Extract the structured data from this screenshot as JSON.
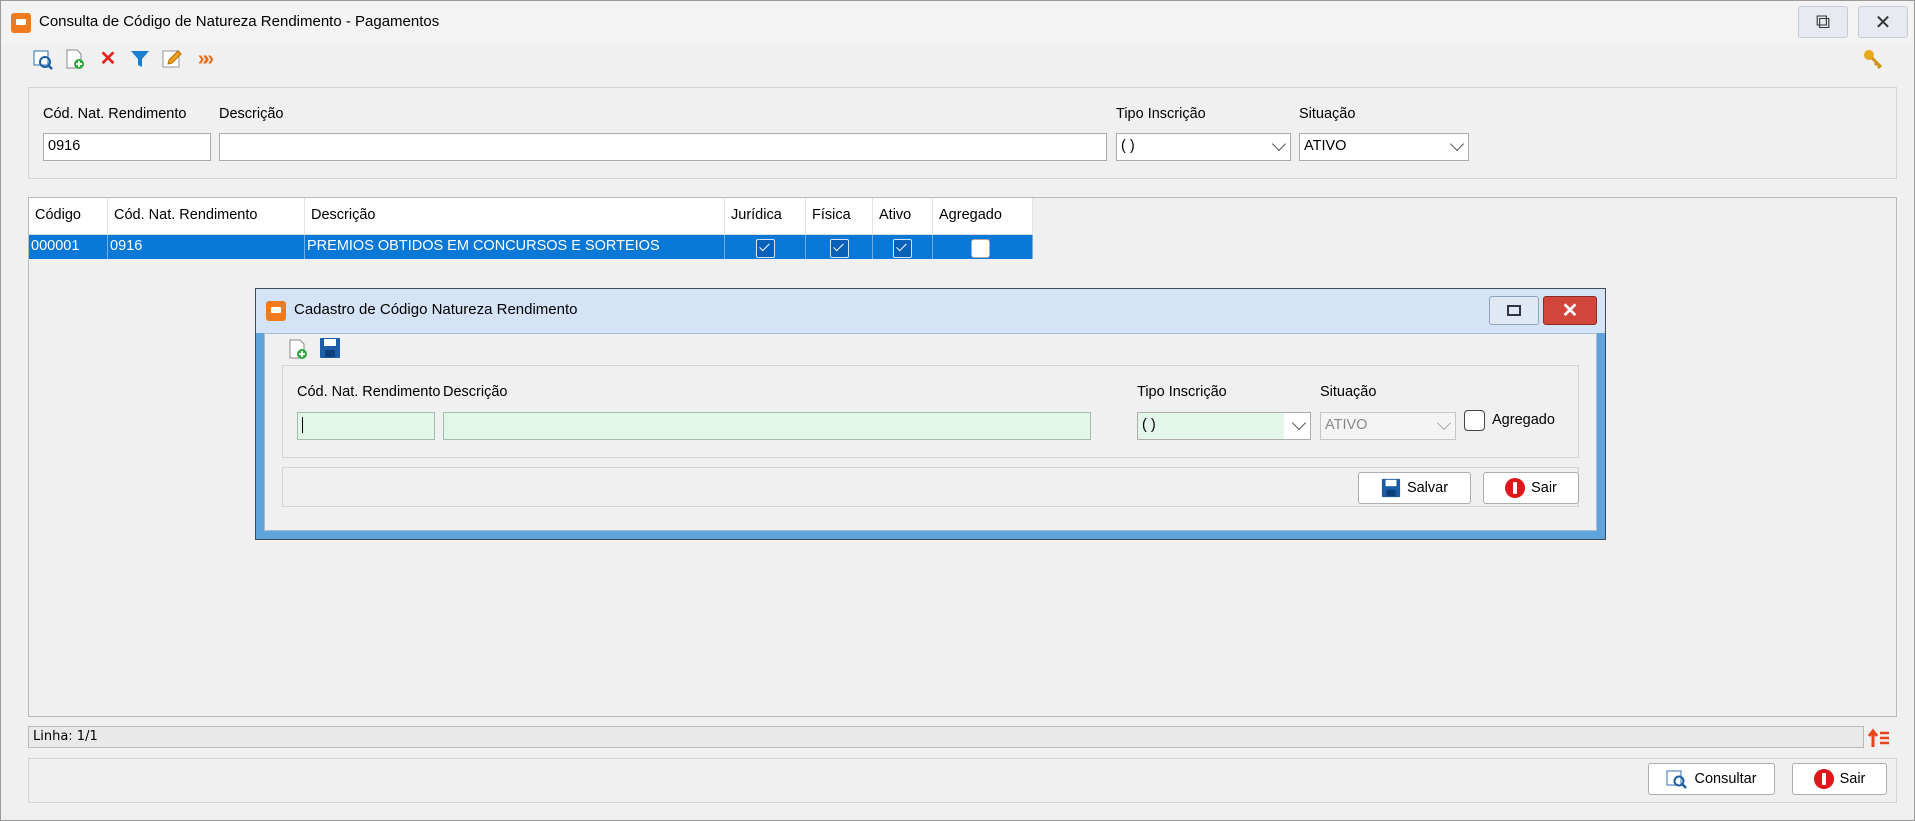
{
  "window": {
    "title": "Consulta de Código de Natureza Rendimento - Pagamentos"
  },
  "toolbar": {
    "icons": [
      "search-icon",
      "new-document-icon",
      "delete-icon",
      "filter-icon",
      "edit-icon",
      "next-icon"
    ],
    "key_icon": "key-icon"
  },
  "filter": {
    "cod_label": "Cód. Nat. Rendimento",
    "cod_value": "0916",
    "descricao_label": "Descrição",
    "descricao_value": "",
    "tipo_label": "Tipo Inscrição",
    "tipo_value": "(   )",
    "situacao_label": "Situação",
    "situacao_value": "ATIVO"
  },
  "grid": {
    "columns": [
      "Código",
      "Cód. Nat. Rendimento",
      "Descrição",
      "Jurídica",
      "Física",
      "Ativo",
      "Agregado"
    ],
    "rows": [
      {
        "codigo": "000001",
        "cod_nat": "0916",
        "descricao": "PREMIOS OBTIDOS EM CONCURSOS E SORTEIOS",
        "juridica": true,
        "fisica": true,
        "ativo": true,
        "agregado": false
      }
    ]
  },
  "status": {
    "linha": "Linha: 1/1"
  },
  "buttons": {
    "consultar": "Consultar",
    "sair": "Sair"
  },
  "dialog": {
    "title": "Cadastro de Código Natureza Rendimento",
    "cod_label": "Cód. Nat. Rendimento",
    "cod_value": "",
    "descricao_label": "Descrição",
    "descricao_value": "",
    "tipo_label": "Tipo Inscrição",
    "tipo_value": "(   )",
    "situacao_label": "Situação",
    "situacao_value": "ATIVO",
    "agregado_label": "Agregado",
    "salvar": "Salvar",
    "sair": "Sair"
  },
  "colors": {
    "selection": "#0a78d7",
    "input_required": "#e2f6ea",
    "accent": "#f07b1c"
  }
}
